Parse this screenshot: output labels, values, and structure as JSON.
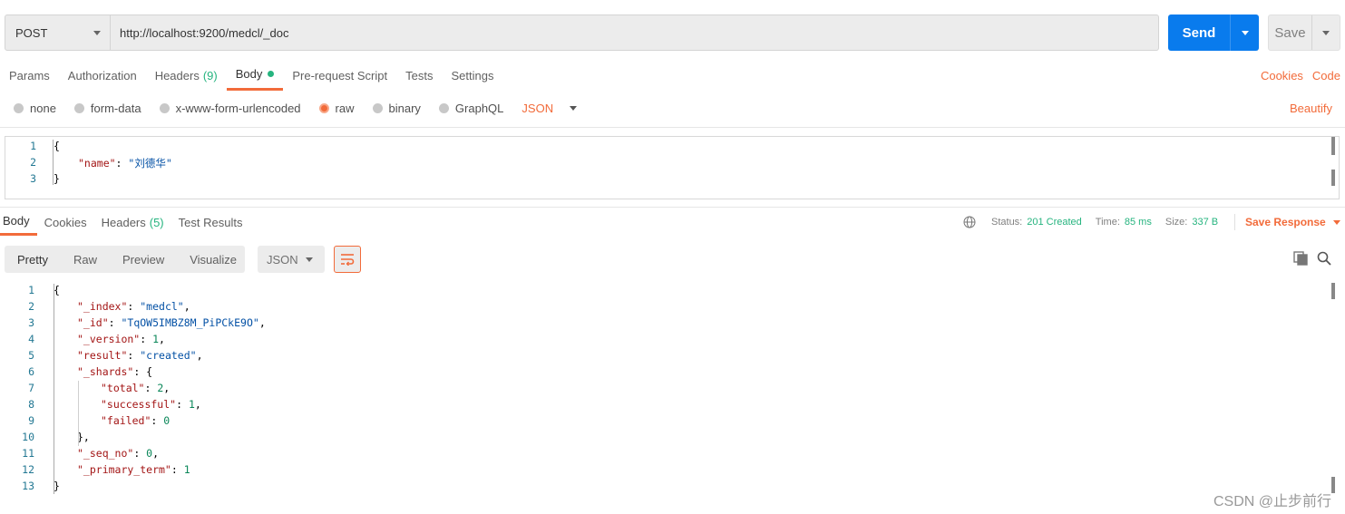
{
  "request": {
    "method": "POST",
    "url": "http://localhost:9200/medcl/_doc",
    "send_label": "Send",
    "save_label": "Save"
  },
  "request_tabs": [
    {
      "label": "Params"
    },
    {
      "label": "Authorization"
    },
    {
      "label": "Headers",
      "count": "(9)"
    },
    {
      "label": "Body"
    },
    {
      "label": "Pre-request Script"
    },
    {
      "label": "Tests"
    },
    {
      "label": "Settings"
    }
  ],
  "links": {
    "cookies": "Cookies",
    "code": "Code"
  },
  "body_types": [
    {
      "label": "none",
      "checked": false
    },
    {
      "label": "form-data",
      "checked": false
    },
    {
      "label": "x-www-form-urlencoded",
      "checked": false
    },
    {
      "label": "raw",
      "checked": true
    },
    {
      "label": "binary",
      "checked": false
    },
    {
      "label": "GraphQL",
      "checked": false
    }
  ],
  "body_language": "JSON",
  "beautify_label": "Beautify",
  "request_body_lines": [
    {
      "num": "1",
      "text": "{"
    },
    {
      "num": "2",
      "key": "\"name\"",
      "value": "\"刘德华\""
    },
    {
      "num": "3",
      "text": "}"
    }
  ],
  "response_tabs": [
    {
      "label": "Body"
    },
    {
      "label": "Cookies"
    },
    {
      "label": "Headers",
      "count": "(5)"
    },
    {
      "label": "Test Results"
    }
  ],
  "response_meta": {
    "status_label": "Status:",
    "status_value": "201 Created",
    "time_label": "Time:",
    "time_value": "85 ms",
    "size_label": "Size:",
    "size_value": "337 B",
    "save_response": "Save Response"
  },
  "view_modes": [
    "Pretty",
    "Raw",
    "Preview",
    "Visualize"
  ],
  "response_format": "JSON",
  "response_lines": [
    {
      "num": "1",
      "indent": 0,
      "text": "{"
    },
    {
      "num": "2",
      "indent": 1,
      "key": "\"_index\"",
      "value": "\"medcl\"",
      "vtype": "s",
      "tail": ","
    },
    {
      "num": "3",
      "indent": 1,
      "key": "\"_id\"",
      "value": "\"TqOW5IMBZ8M_PiPCkE9O\"",
      "vtype": "s",
      "tail": ","
    },
    {
      "num": "4",
      "indent": 1,
      "key": "\"_version\"",
      "value": "1",
      "vtype": "n",
      "tail": ","
    },
    {
      "num": "5",
      "indent": 1,
      "key": "\"result\"",
      "value": "\"created\"",
      "vtype": "s",
      "tail": ","
    },
    {
      "num": "6",
      "indent": 1,
      "key": "\"_shards\"",
      "value": "{",
      "vtype": "p",
      "tail": ""
    },
    {
      "num": "7",
      "indent": 2,
      "key": "\"total\"",
      "value": "2",
      "vtype": "n",
      "tail": ","
    },
    {
      "num": "8",
      "indent": 2,
      "key": "\"successful\"",
      "value": "1",
      "vtype": "n",
      "tail": ","
    },
    {
      "num": "9",
      "indent": 2,
      "key": "\"failed\"",
      "value": "0",
      "vtype": "n",
      "tail": ""
    },
    {
      "num": "10",
      "indent": 1,
      "text": "},"
    },
    {
      "num": "11",
      "indent": 1,
      "key": "\"_seq_no\"",
      "value": "0",
      "vtype": "n",
      "tail": ","
    },
    {
      "num": "12",
      "indent": 1,
      "key": "\"_primary_term\"",
      "value": "1",
      "vtype": "n",
      "tail": ""
    },
    {
      "num": "13",
      "indent": 0,
      "text": "}"
    }
  ],
  "watermark": "CSDN @止步前行",
  "colors": {
    "accent": "#f26b3a",
    "send": "#097bed",
    "success": "#26b47f"
  }
}
